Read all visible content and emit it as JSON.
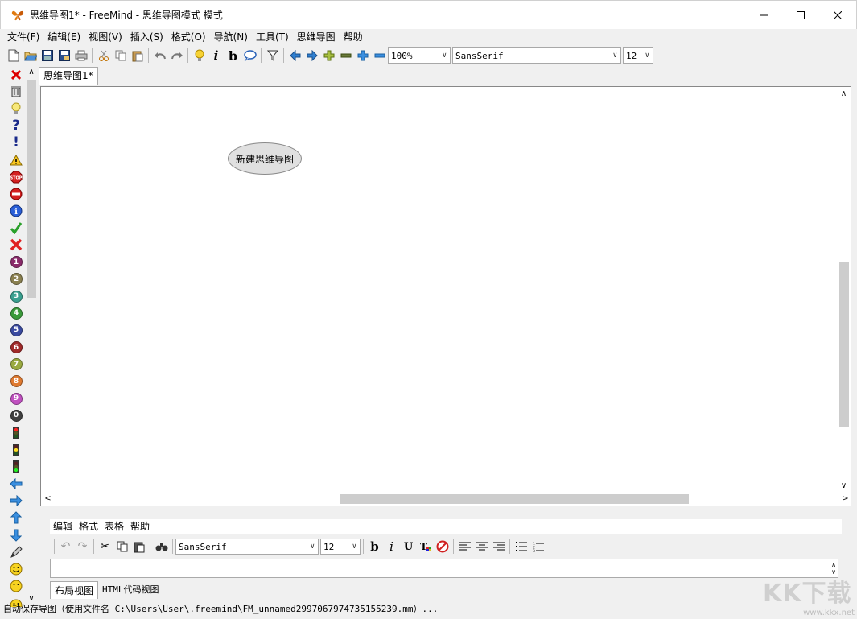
{
  "window": {
    "title": "思维导图1* - FreeMind - 思维导图模式 模式"
  },
  "menu": [
    "文件(F)",
    "编辑(E)",
    "视图(V)",
    "插入(S)",
    "格式(O)",
    "导航(N)",
    "工具(T)",
    "思维导图",
    "帮助"
  ],
  "toolbar": {
    "zoom": "100%",
    "font": "SansSerif",
    "font_size": "12"
  },
  "tabs": [
    {
      "label": "思维导图1*"
    }
  ],
  "canvas": {
    "root_node": "新建思维导图"
  },
  "editor": {
    "menu": [
      "编辑",
      "格式",
      "表格",
      "帮助"
    ],
    "font": "SansSerif",
    "font_size": "12",
    "view_tabs": [
      "布局视图",
      "HTML代码视图"
    ]
  },
  "status": "自动保存导图（使用文件名 C:\\Users\\User\\.freemind\\FM_unnamed2997067974735155239.mm）...",
  "watermark": {
    "logo": "KK下载",
    "url": "www.kkx.net"
  }
}
